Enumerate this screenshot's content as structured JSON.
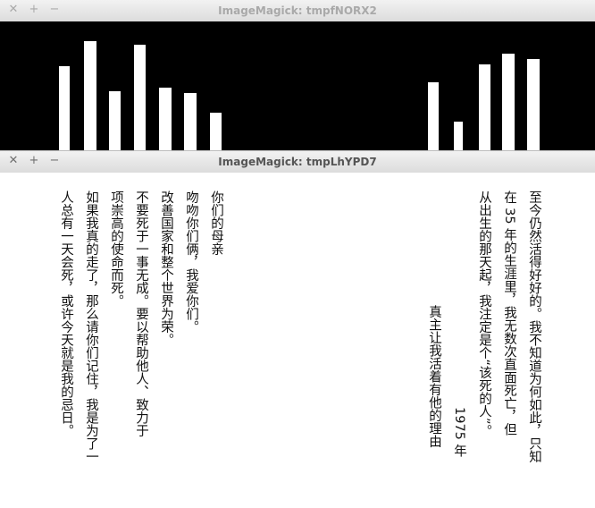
{
  "windows": [
    {
      "title": "ImageMagick: tmpfNORX2",
      "controls": [
        "✕",
        "+",
        "−"
      ]
    },
    {
      "title": "ImageMagick: tmpLhYPD7",
      "controls": [
        "✕",
        "+",
        "−"
      ],
      "left_text": {
        "lines": [
          "人总有一天会死，或许今天就是我的忌日。",
          "如果我真的走了，那么请你们记住，我是为了一",
          "项崇高的使命而死。",
          "不要死于一事无成。要以帮助他人、致力于",
          "改善国家和整个世界为荣。",
          "吻吻你们俩，我爱你们。",
          "你们的母亲"
        ]
      },
      "right_text": {
        "lines": [
          "真主让我活着有他的理由",
          "1975 年",
          "从出生的那天起，我注定是个“该死的人”。",
          "在 35 年的生涯里，我无数次直面死亡，但",
          "至今仍然活得好好的。我不知道为何如此，只知"
        ]
      }
    }
  ]
}
